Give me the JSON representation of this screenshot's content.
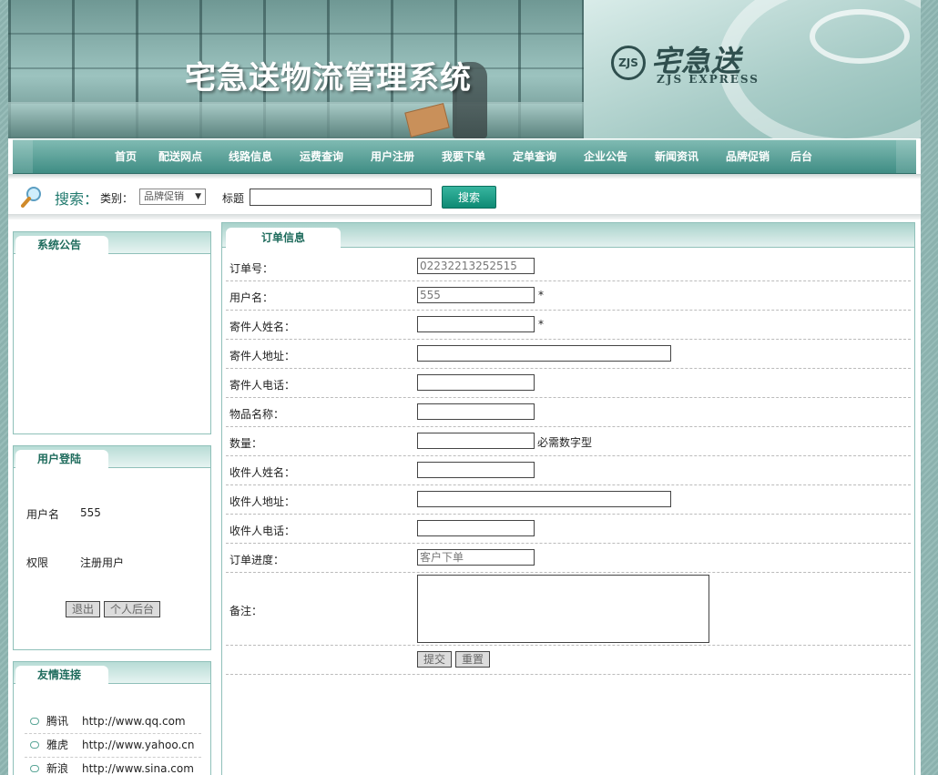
{
  "banner": {
    "title": "宅急送物流管理系统",
    "logo_cn": "宅急送",
    "logo_en": "ZJS EXPRESS",
    "seal": "ZJS"
  },
  "nav": [
    "首页",
    "配送网点",
    "线路信息",
    "运费查询",
    "用户注册",
    "我要下单",
    "定单查询",
    "企业公告",
    "新闻资讯",
    "品牌促销",
    "后台"
  ],
  "search": {
    "label": "搜索：",
    "category_label": "类别：",
    "category_value": "品牌促销",
    "title_label": "标题",
    "title_value": "",
    "button": "搜索"
  },
  "notice_panel": {
    "title": "系统公告"
  },
  "login_panel": {
    "title": "用户登陆",
    "username_label": "用户名",
    "username_value": "555",
    "role_label": "权限",
    "role_value": "注册用户",
    "logout": "退出",
    "personal": "个人后台"
  },
  "links_panel": {
    "title": "友情连接",
    "links": [
      {
        "name": "腾讯",
        "url": "http://www.qq.com"
      },
      {
        "name": "雅虎",
        "url": "http://www.yahoo.cn"
      },
      {
        "name": "新浪",
        "url": "http://www.sina.com"
      }
    ]
  },
  "order": {
    "tab": "订单信息",
    "fields": {
      "order_no": {
        "label": "订单号：",
        "value": "02232213252515"
      },
      "username": {
        "label": "用户名：",
        "value": "555",
        "note": "*"
      },
      "sender_name": {
        "label": "寄件人姓名：",
        "value": "",
        "note": "*"
      },
      "sender_addr": {
        "label": "寄件人地址：",
        "value": ""
      },
      "sender_phone": {
        "label": "寄件人电话：",
        "value": ""
      },
      "item_name": {
        "label": "物品名称：",
        "value": ""
      },
      "quantity": {
        "label": "数量：",
        "value": "",
        "note": "必需数字型"
      },
      "recv_name": {
        "label": "收件人姓名：",
        "value": ""
      },
      "recv_addr": {
        "label": "收件人地址：",
        "value": ""
      },
      "recv_phone": {
        "label": "收件人电话：",
        "value": ""
      },
      "progress": {
        "label": "订单进度：",
        "value": "客户下单"
      },
      "remark": {
        "label": "备注：",
        "value": ""
      }
    },
    "submit": "提交",
    "reset": "重置"
  }
}
